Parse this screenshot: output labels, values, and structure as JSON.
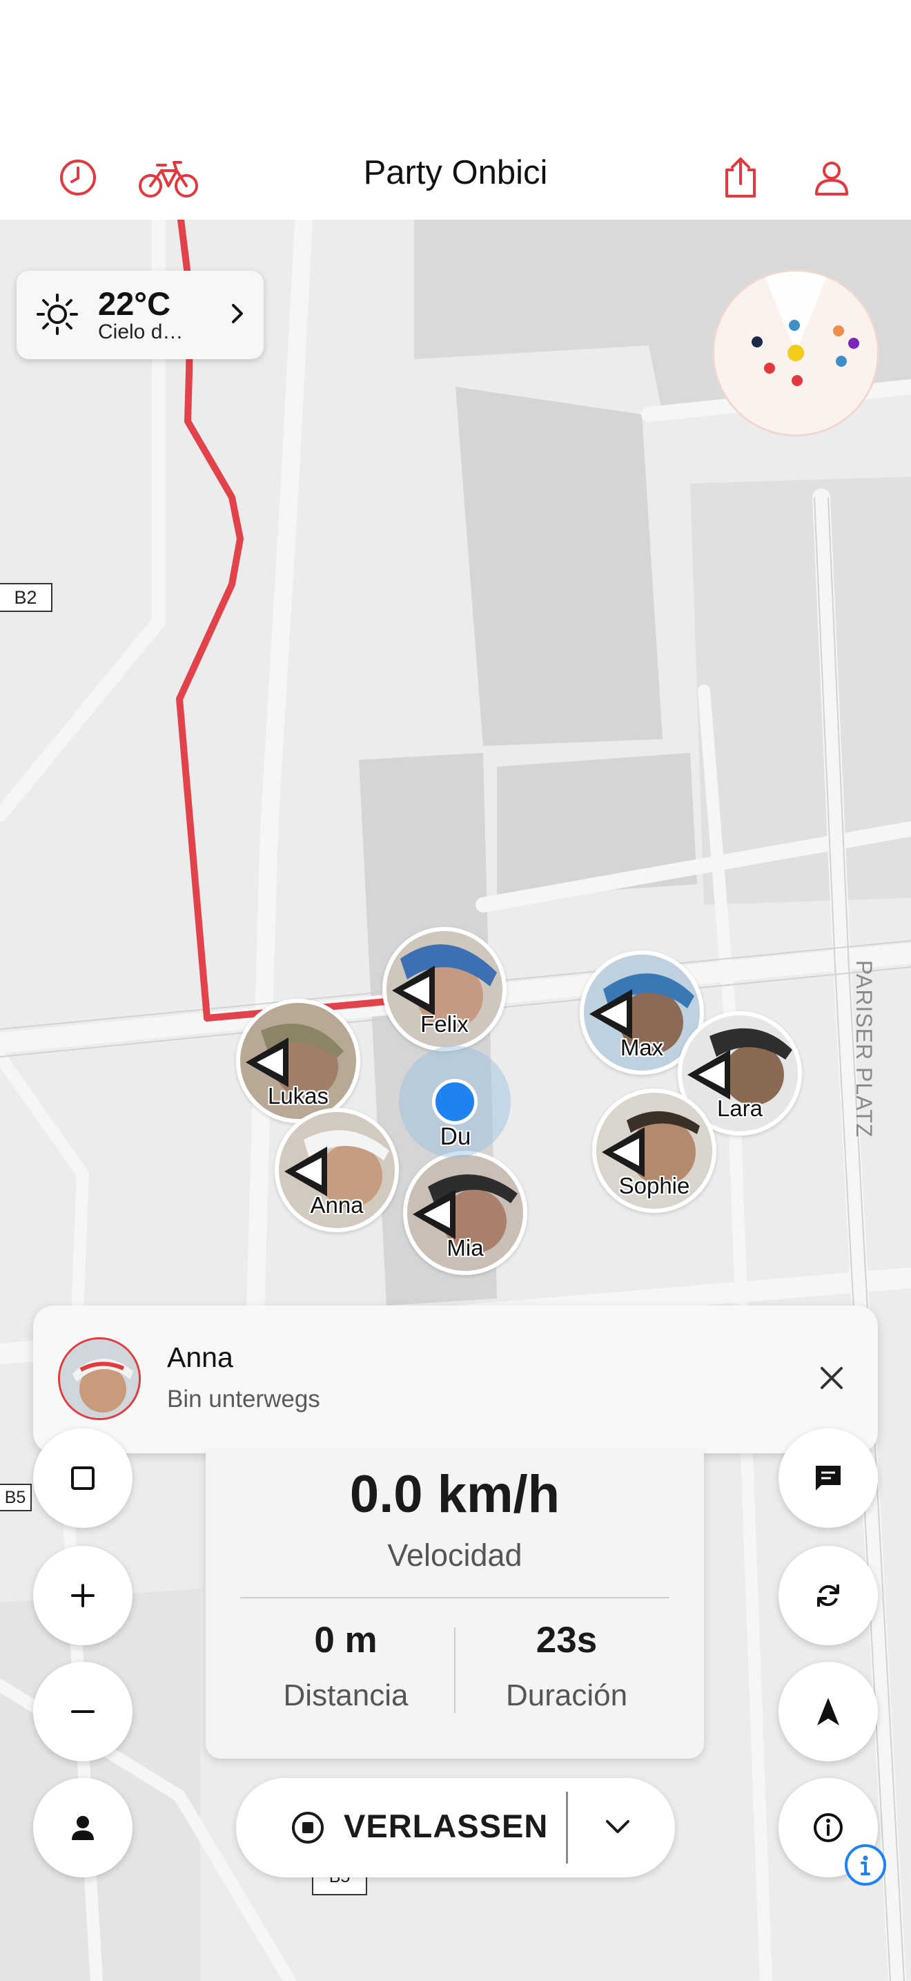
{
  "header": {
    "title": "Party Onbici",
    "icons": [
      "history-icon",
      "bike-icon",
      "share-icon",
      "profile-icon"
    ],
    "accent_color": "#e2383f"
  },
  "weather": {
    "temperature": "22°C",
    "description": "Cielo d…"
  },
  "map": {
    "road_labels": {
      "b2": "B2",
      "b5_left": "B5",
      "b5_bottom": "B5"
    },
    "street_name": "PARISER PLATZ",
    "route_color": "#e2434a"
  },
  "riders": [
    {
      "name": "Felix"
    },
    {
      "name": "Lukas"
    },
    {
      "name": "Max"
    },
    {
      "name": "Lara"
    },
    {
      "name": "Sophie"
    },
    {
      "name": "Anna"
    },
    {
      "name": "Mia"
    }
  ],
  "me": {
    "label": "Du"
  },
  "notification": {
    "sender": "Anna",
    "message": "Bin unterwegs"
  },
  "stats": {
    "speed": "0.0 km/h",
    "speed_label": "Velocidad",
    "distance": "0 m",
    "distance_label": "Distancia",
    "duration": "23s",
    "duration_label": "Duración"
  },
  "controls": {
    "leave_label": "VERLASSEN",
    "left_buttons": [
      "stop-square-icon",
      "zoom-in-icon",
      "zoom-out-icon",
      "person-icon"
    ],
    "right_buttons": [
      "chat-icon",
      "refresh-icon",
      "navigate-icon",
      "info-icon"
    ]
  }
}
